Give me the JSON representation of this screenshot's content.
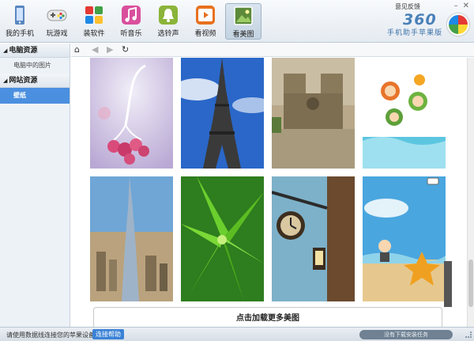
{
  "toolbar": {
    "items": [
      {
        "label": "我的手机",
        "icon": "phone-icon"
      },
      {
        "label": "玩游戏",
        "icon": "gamepad-icon"
      },
      {
        "label": "装软件",
        "icon": "apps-icon"
      },
      {
        "label": "听音乐",
        "icon": "music-icon"
      },
      {
        "label": "选铃声",
        "icon": "bell-icon"
      },
      {
        "label": "看视频",
        "icon": "video-icon"
      },
      {
        "label": "看美图",
        "icon": "picture-icon"
      }
    ],
    "active": "看美图",
    "feedback": "意见反馈"
  },
  "brand": {
    "number": "360",
    "subtitle": "手机助手苹果版"
  },
  "sidebar": {
    "sections": [
      {
        "title": "电脑资源",
        "items": [
          "电脑中的图片"
        ]
      },
      {
        "title": "网站资源",
        "items": [
          "壁纸"
        ]
      }
    ],
    "active_item": "壁纸"
  },
  "content": {
    "load_more": "点击加载更多美图"
  },
  "status": {
    "text": "请使用数据线连接您的苹果设备",
    "help_button": "连接帮助",
    "tasks": "没有下载安装任务"
  },
  "colors": {
    "accent": "#4a8fe0",
    "help_button": "#3b82d6"
  }
}
